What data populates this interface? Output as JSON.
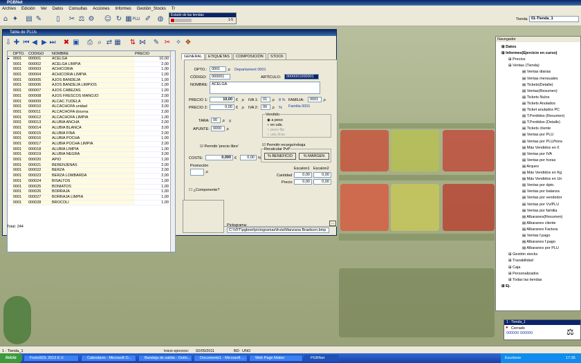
{
  "app": {
    "title": "PGBNet",
    "menu": [
      "Archivo",
      "Edición",
      "Ver",
      "Datos",
      "Consultas",
      "Acciones",
      "Informes",
      "Gestión_Stocks",
      "Tr"
    ],
    "estado_label": "Estado de las tiendas",
    "estado_count": "1-5",
    "tienda_label": "Tienda",
    "tienda_value": "01-Tienda_1"
  },
  "window": {
    "title": "Tabla de PLUs",
    "total_label": "Total:",
    "total_value": "244",
    "columns": [
      "DPTO.",
      "CODIGO",
      "NOMBRE",
      "PRECIO"
    ],
    "rows": [
      [
        "0001",
        "000001",
        "ACELGA",
        "10,00"
      ],
      [
        "0001",
        "000002",
        "ACELGA LIMPIA",
        "2,00"
      ],
      [
        "0001",
        "000003",
        "ACHICORIA",
        "1,00"
      ],
      [
        "0001",
        "000004",
        "ACHICORIA LIMPIA",
        "1,00"
      ],
      [
        "0001",
        "000005",
        "AJOS BANDEJA",
        "1,00"
      ],
      [
        "0001",
        "000006",
        "AJOS BANDEJA LIMPIOS",
        "1,00"
      ],
      [
        "0001",
        "000007",
        "AJOS CABEZAS",
        "1,00"
      ],
      [
        "0001",
        "000008",
        "AJOS FRESCOS MANOJO",
        "2,00"
      ],
      [
        "0001",
        "000009",
        "ALCAC.TUDELA",
        "2,00"
      ],
      [
        "0001",
        "000010",
        "ALCACHOFA unidad",
        "3,00"
      ],
      [
        "0001",
        "000011",
        "ALCACHOFA docena",
        "2,00"
      ],
      [
        "0001",
        "000012",
        "ALCACHOFA LIMPIA",
        "1,00"
      ],
      [
        "0001",
        "000013",
        "ALUBIA ANCHA",
        "2,00"
      ],
      [
        "0001",
        "000014",
        "ALUBIA BLANCA",
        "3,00"
      ],
      [
        "0001",
        "000015",
        "ALUBIA FINA",
        "2,00"
      ],
      [
        "0001",
        "000016",
        "ALUBIA POCHA",
        "1,00"
      ],
      [
        "0001",
        "000017",
        "ALUBIA POCHA LIMPIA",
        "2,00"
      ],
      [
        "0001",
        "000018",
        "ALUBIA LIMPIA",
        "1,00"
      ],
      [
        "0001",
        "000019",
        "ALUBIA NEGRA",
        "3,00"
      ],
      [
        "0001",
        "000020",
        "APIO",
        "1,00"
      ],
      [
        "0001",
        "000021",
        "BERENJENAS",
        "2,00"
      ],
      [
        "0001",
        "000022",
        "BERZA",
        "2,00"
      ],
      [
        "0001",
        "000023",
        "BERZA LOMBARDA",
        "2,00"
      ],
      [
        "0001",
        "000024",
        "BISALTOS",
        "1,00"
      ],
      [
        "0001",
        "000025",
        "BONIATOS",
        "1,00"
      ],
      [
        "0001",
        "000026",
        "BORRAJA",
        "1,00"
      ],
      [
        "0001",
        "000027",
        "BORRAJA LIMPIA",
        "1,00"
      ],
      [
        "0001",
        "000028",
        "BROCOLI",
        "1,00"
      ]
    ]
  },
  "tabs": [
    "GENERAL",
    "ETIQUETAS",
    "COMPOSICIÓN",
    "STOCK"
  ],
  "form": {
    "dpto_label": "DPTO.:",
    "dpto_value": "0001",
    "dpto_desc": "Departament 0001",
    "codigo_label": "CÓDIGO:",
    "codigo_value": "000001",
    "articulo_label": "ARTÍCULO:",
    "articulo_value": "0000001000001",
    "nombre_label": "NOMBRE:",
    "nombre_value": "ACELGA",
    "precio1_label": "PRECIO 1:",
    "precio1_value": "10,00",
    "precio2_label": "PRECIO 2:",
    "precio2_value": "0,00",
    "currency": "€",
    "iva1_label": "IVA 1:",
    "iva1_value": "01",
    "iva1_pct": "8 %",
    "iva2_label": "IVA 2:",
    "iva2_value": "00",
    "iva2_pct": "%",
    "familia_label": "FAMILIA:",
    "familia_value": "0001",
    "familia_desc": "Familia 0001",
    "tara_label": "TARA:",
    "tara_value": "00",
    "tara_unit": "g",
    "apunte_label": "APUNTE:",
    "apunte_value": "0000",
    "vendido_label": "Vendido",
    "vendido_opts": [
      "a peso",
      "en uds.",
      "peso fijo",
      "uds./tras"
    ],
    "precio_libre": "Permitir 'precio libre'",
    "recargo": "Permitir recargo/rebaja",
    "coste_label": "COSTE:",
    "coste_value": "0,000",
    "coste_currency": "€",
    "coste_pct": "0,00",
    "pct_sign": "%",
    "recalcular": "Recalcular PvP",
    "beneficio": "% BENEFICIO",
    "margen": "% MARGEN",
    "promocion": "Promoción",
    "escalon1": "Escalon1",
    "escalon2": "Escalon2",
    "cantidad_label": "Cantidad",
    "cantidad": [
      "0,00",
      "0,00"
    ],
    "precio_label": "Precio",
    "precio": [
      "0,00",
      "0,00"
    ],
    "componente": "¿Componente?",
    "pictograma_label": "Pictograma:",
    "pictograma_value": "C:\\VFT\\pgbnet\\pictogramas\\fruta\\Manzana Braeburn.bmp"
  },
  "navigator": {
    "title": "Navegador",
    "items": [
      {
        "t": "Datos",
        "x": 8,
        "b": true
      },
      {
        "t": "Informes(Ejercicio en curso)",
        "x": 8,
        "b": true
      },
      {
        "t": "Precios",
        "x": 18
      },
      {
        "t": "Ventas (Tienda)",
        "x": 18
      },
      {
        "t": "Ventas diarias",
        "x": 38
      },
      {
        "t": "Ventas mensuales",
        "x": 38
      },
      {
        "t": "Tickets(Detalle)",
        "x": 38
      },
      {
        "t": "Ventas(Resumen)",
        "x": 38
      },
      {
        "t": "Tickets Nulos",
        "x": 38
      },
      {
        "t": "Tickets Anulados",
        "x": 38
      },
      {
        "t": "Ticket anulados PC",
        "x": 38
      },
      {
        "t": "T.Perdidos (Resumen)",
        "x": 38
      },
      {
        "t": "T.Perdidos (Detalle)",
        "x": 38
      },
      {
        "t": "Tickets cliente",
        "x": 38
      },
      {
        "t": "Ventas por PLU",
        "x": 38
      },
      {
        "t": "Ventas por PLU/hora",
        "x": 38
      },
      {
        "t": "Más Vendidos en €",
        "x": 38
      },
      {
        "t": "Ventas por IVA",
        "x": 38
      },
      {
        "t": "Ventas por horas",
        "x": 38
      },
      {
        "t": "Arqueo",
        "x": 38
      },
      {
        "t": "Más Vendidos en Kg",
        "x": 38
      },
      {
        "t": "Más Vendidos en Un",
        "x": 38
      },
      {
        "t": "Ventas por dpto.",
        "x": 38
      },
      {
        "t": "Ventas por balanza",
        "x": 38
      },
      {
        "t": "Ventas por vendedor",
        "x": 38
      },
      {
        "t": "Ventas por Vv/PLU",
        "x": 38
      },
      {
        "t": "Ventas por familia",
        "x": 38
      },
      {
        "t": "Albaranes(Resumen)",
        "x": 38
      },
      {
        "t": "Albaranes cliente",
        "x": 38
      },
      {
        "t": "Albaranes Factura",
        "x": 38
      },
      {
        "t": "Ventas f.pago",
        "x": 38
      },
      {
        "t": "Albaranes f.pago",
        "x": 38
      },
      {
        "t": "Albaranes por PLU",
        "x": 38
      },
      {
        "t": "Gestión stocks",
        "x": 18
      },
      {
        "t": "Trazabilidad",
        "x": 18
      },
      {
        "t": "Caja",
        "x": 18
      },
      {
        "t": "Personalizados",
        "x": 18
      },
      {
        "t": "Todas las tiendas",
        "x": 18
      },
      {
        "t": "Ej.",
        "x": 8,
        "b": true
      }
    ]
  },
  "tienda_panel": {
    "title": "1 - Tienda_1",
    "estado": "Cerrado",
    "code": "000000 000000"
  },
  "status": {
    "tienda": "1 - Tienda_1",
    "inicio_label": "Inicio ejercicio:",
    "inicio": "02/05/2011",
    "bd_label": "BD:",
    "bd": "UNO"
  },
  "taskbar": {
    "start": "Inicio",
    "tasks": [
      "FoxtoSOL 2012 E.V.",
      "Calendario - Microsoft O...",
      "Bandeja de salida - Outlo...",
      "Documento1 - Microsoft ...",
      "Web Page Maker",
      "PGBNet"
    ],
    "lang": "Escritorio",
    "clock": "17:35"
  }
}
